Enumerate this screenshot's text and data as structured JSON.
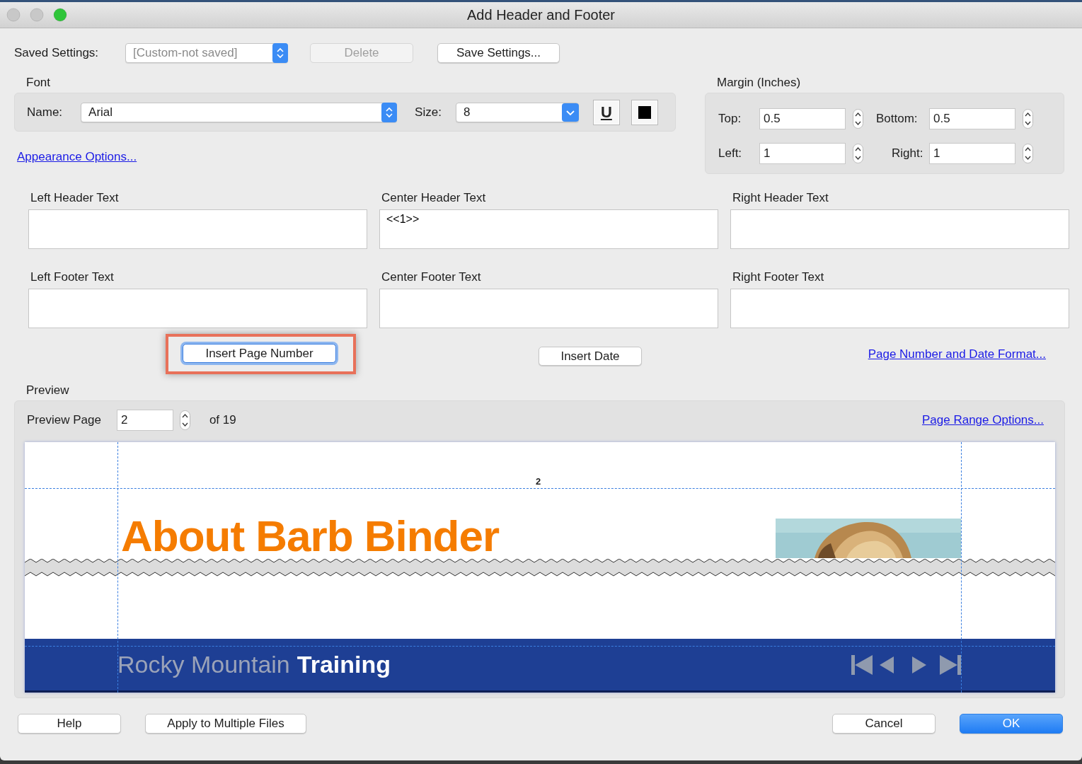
{
  "window": {
    "title": "Add Header and Footer"
  },
  "saved_settings": {
    "label": "Saved Settings:",
    "value": "[Custom-not saved]",
    "disabled": true
  },
  "toolbar_buttons": [
    {
      "label": "Delete",
      "disabled": true
    },
    {
      "label": "Save Settings...",
      "disabled": false
    }
  ],
  "font": {
    "title": "Font",
    "name_label": "Name:",
    "name": "Arial",
    "size_label": "Size:",
    "size": "8",
    "underline_button": "U"
  },
  "appearance_link": "Appearance Options...",
  "margin": {
    "title": "Margin (Inches)",
    "fields": [
      {
        "label": "Top:",
        "value": "0.5"
      },
      {
        "label": "Bottom:",
        "value": "0.5"
      },
      {
        "label": "Left:",
        "value": "1"
      },
      {
        "label": "Right:",
        "value": "1"
      }
    ]
  },
  "text_boxes": [
    {
      "label": "Left Header Text"
    },
    {
      "label": "Center Header Text",
      "value": "<<1>>"
    },
    {
      "label": "Right Header Text"
    },
    {
      "label": "Left Footer Text"
    },
    {
      "label": "Center Footer Text"
    },
    {
      "label": "Right Footer Text"
    }
  ],
  "insert_buttons": [
    {
      "label": "Insert Page Number",
      "highlighted": true
    },
    {
      "label": "Insert Date",
      "highlighted": false
    }
  ],
  "format_link": "Page Number and Date Format...",
  "preview": {
    "title": "Preview",
    "page_label": "Preview Page",
    "page": "2",
    "page_count": "of 19",
    "range_link": "Page Range Options...",
    "header_number": "2",
    "heading": "About Barb Binder",
    "footer_light": "Rocky Mountain",
    "footer_bold": "Training"
  },
  "buttons": [
    {
      "label": "Help",
      "default": false
    },
    {
      "label": "Apply to Multiple Files",
      "default": false
    },
    {
      "label": "Cancel",
      "default": false
    },
    {
      "label": "OK",
      "default": true
    }
  ]
}
